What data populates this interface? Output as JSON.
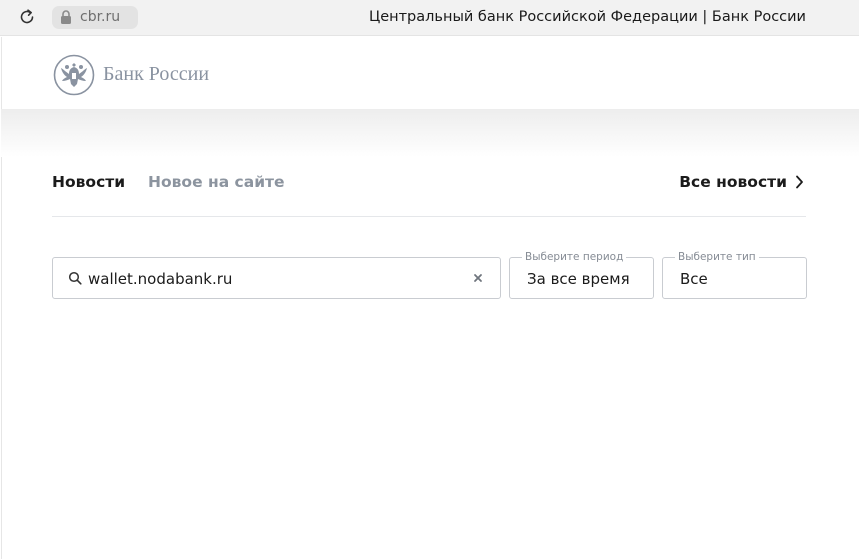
{
  "browser": {
    "url": "cbr.ru",
    "tab_title": "Центральный банк Российской Федерации | Банк России",
    "icons": [
      "reload-icon",
      "lock-icon"
    ]
  },
  "header": {
    "logo_text": "Банк России",
    "logo_icon": "double-headed-eagle-emblem"
  },
  "news": {
    "tabs": [
      {
        "label": "Новости",
        "active": true
      },
      {
        "label": "Новое на сайте",
        "active": false
      }
    ],
    "all_news_label": "Все новости"
  },
  "filters": {
    "search": {
      "value": "wallet.nodabank.ru",
      "icon": "search-icon",
      "clear_icon": "clear-icon"
    },
    "period": {
      "legend": "Выберите период",
      "value": "За все время"
    },
    "type": {
      "legend": "Выберите тип",
      "value": "Все"
    }
  },
  "colors": {
    "text_primary": "#1b1b1b",
    "text_muted": "#8c949f",
    "logo_gray": "#8a93a1",
    "border": "#c9ccd1"
  }
}
